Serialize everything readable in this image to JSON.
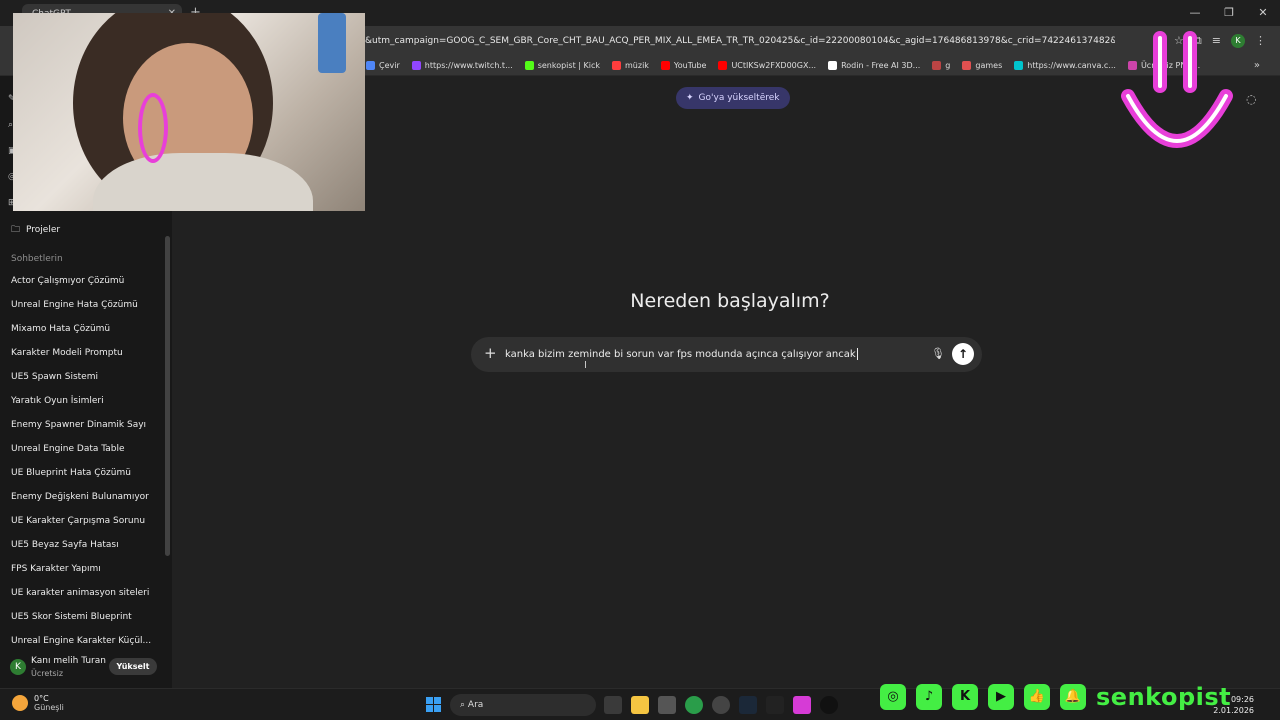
{
  "browser": {
    "tab_title": "ChatGPT",
    "url": "&utm_campaign=GOOG_C_SEM_GBR_Core_CHT_BAU_ACQ_PER_MIX_ALL_EMEA_TR_TR_020425&c_id=22200080104&c_agid=176486813978&c_crid=742246137482&c_kwid={keyw...",
    "profile_initial": "K",
    "bookmarks": [
      {
        "label": "Çevir",
        "color": "#4f86f7"
      },
      {
        "label": "https://www.twitch.t...",
        "color": "#9146ff"
      },
      {
        "label": "senkopist | Kick",
        "color": "#53fc18"
      },
      {
        "label": "müzik",
        "color": "#ff3d3d"
      },
      {
        "label": "YouTube",
        "color": "#ff0000"
      },
      {
        "label": "UCtIKSw2FXD00GX...",
        "color": "#ff0000"
      },
      {
        "label": "Rodin - Free AI 3D...",
        "color": "#ffffff"
      },
      {
        "label": "g",
        "color": "#b44"
      },
      {
        "label": "games",
        "color": "#e05050"
      },
      {
        "label": "https://www.canva.c...",
        "color": "#00c4cc"
      },
      {
        "label": "Ücretsiz PNG...",
        "color": "#cc44aa"
      }
    ]
  },
  "sidebar": {
    "projects_label": "Projeler",
    "section_title": "Sohbetlerin",
    "chats": [
      "Actor Çalışmıyor Çözümü",
      "Unreal Engine Hata Çözümü",
      "Mixamo Hata Çözümü",
      "Karakter Modeli Promptu",
      "UE5 Spawn Sistemi",
      "Yaratık Oyun İsimleri",
      "Enemy Spawner Dinamik Sayı",
      "Unreal Engine Data Table",
      "UE Blueprint Hata Çözümü",
      "Enemy Değişkeni Bulunamıyor",
      "UE Karakter Çarpışma Sorunu",
      "UE5 Beyaz Sayfa Hatası",
      "FPS Karakter Yapımı",
      "UE karakter animasyon siteleri",
      "UE5 Skor Sistemi Blueprint",
      "Unreal Engine Karakter Küçül..."
    ],
    "user": {
      "initial": "K",
      "name": "Kanı melih Turan",
      "plan": "Ücretsiz",
      "upgrade_label": "Yükselt"
    }
  },
  "main": {
    "go_badge": "Go'ya yükseltērek",
    "heading": "Nereden başlayalım?",
    "composer_text": "kanka bizim zeminde bi sorun var fps modunda açınca çalışıyor ancak"
  },
  "taskbar": {
    "temperature": "0°C",
    "weather": "Güneşli",
    "search_label": "Ara",
    "time": "09:26",
    "date": "2.01.2026"
  },
  "overlay": {
    "brand": "senkopist",
    "accent": "#44ee44",
    "smiley_color": "#e83fd9"
  }
}
